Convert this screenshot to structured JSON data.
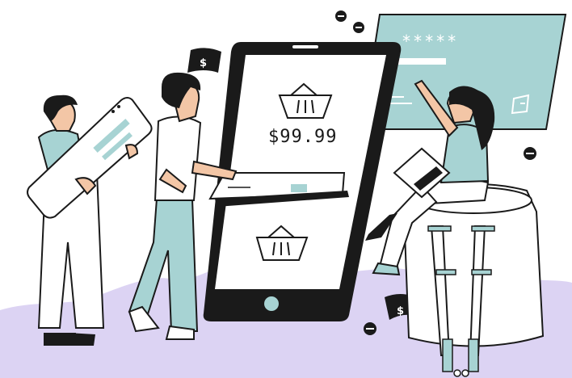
{
  "illustration": {
    "price": "$99.99",
    "password_mask": "*****",
    "currency_symbol": "$"
  },
  "colors": {
    "teal": "#a7d3d3",
    "lavender": "#dcd3f3",
    "ink": "#1a1a1a",
    "skin": "#f3c6a6"
  }
}
